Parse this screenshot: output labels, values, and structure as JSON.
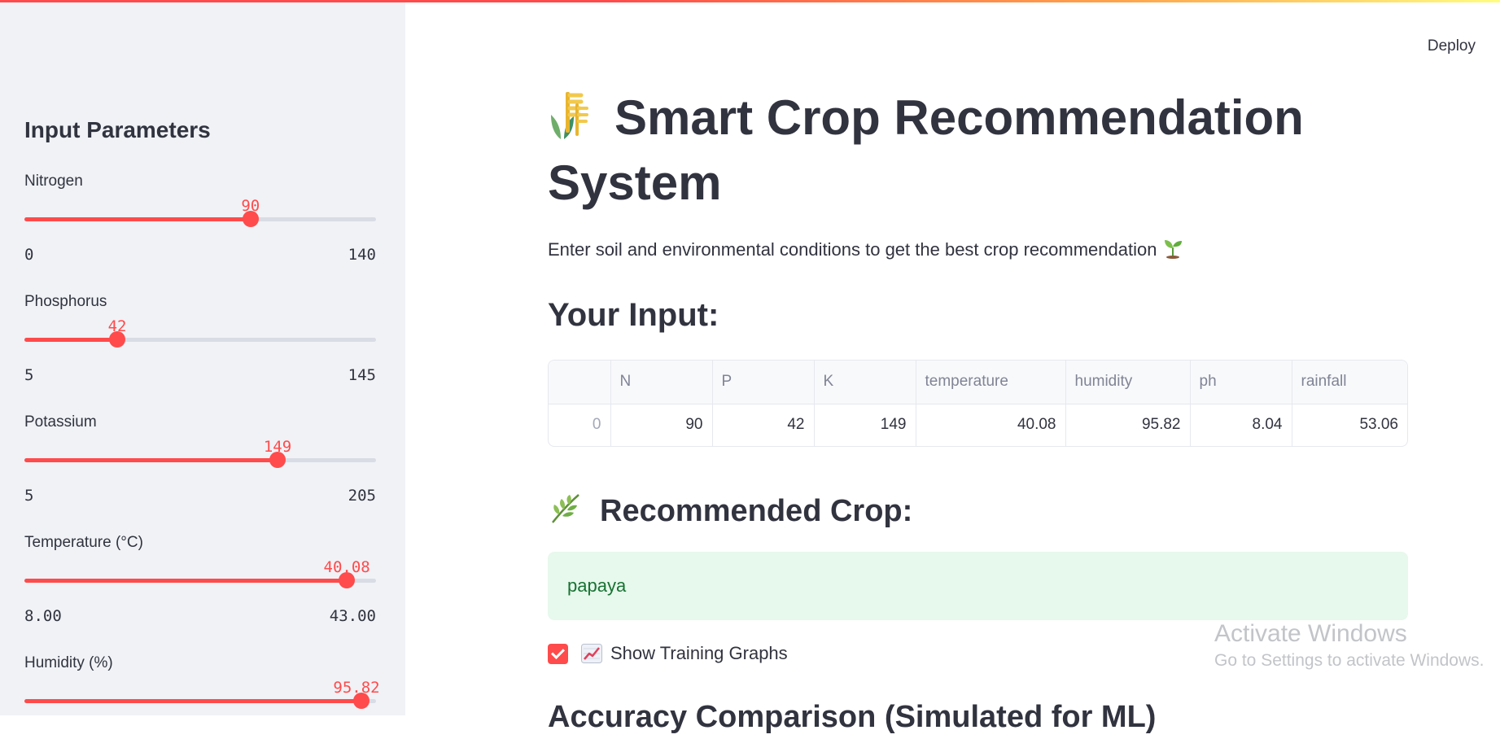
{
  "app": {
    "deploy_label": "Deploy",
    "accent_color": "#ff4b4b"
  },
  "sidebar": {
    "heading": "Input Parameters",
    "sliders": [
      {
        "label": "Nitrogen",
        "value": "90",
        "min": "0",
        "max": "140",
        "fraction": 0.643
      },
      {
        "label": "Phosphorus",
        "value": "42",
        "min": "5",
        "max": "145",
        "fraction": 0.264
      },
      {
        "label": "Potassium",
        "value": "149",
        "min": "5",
        "max": "205",
        "fraction": 0.72
      },
      {
        "label": "Temperature (°C)",
        "value": "40.08",
        "min": "8.00",
        "max": "43.00",
        "fraction": 0.917
      },
      {
        "label": "Humidity (%)",
        "value": "95.82",
        "min": "",
        "max": "",
        "fraction": 0.958
      }
    ]
  },
  "main": {
    "title": "Smart Crop Recommendation System",
    "title_icon": "wheat-icon",
    "subtitle": "Enter soil and environmental conditions to get the best crop recommendation",
    "subtitle_icon": "seedling-icon",
    "input_heading": "Your Input:",
    "table": {
      "columns": [
        "",
        "N",
        "P",
        "K",
        "temperature",
        "humidity",
        "ph",
        "rainfall"
      ],
      "rows": [
        [
          "0",
          "90",
          "42",
          "149",
          "40.08",
          "95.82",
          "8.04",
          "53.06"
        ]
      ]
    },
    "recommend_heading": "Recommended Crop:",
    "recommend_icon": "herb-leaf-icon",
    "recommended_crop": "papaya",
    "show_graphs_label": "Show Training Graphs",
    "show_graphs_checked": true,
    "show_graphs_icon": "chart-increasing-icon",
    "next_heading_partial": "Accuracy Comparison (Simulated for ML)"
  },
  "watermark": {
    "title": "Activate Windows",
    "subtitle": "Go to Settings to activate Windows."
  }
}
